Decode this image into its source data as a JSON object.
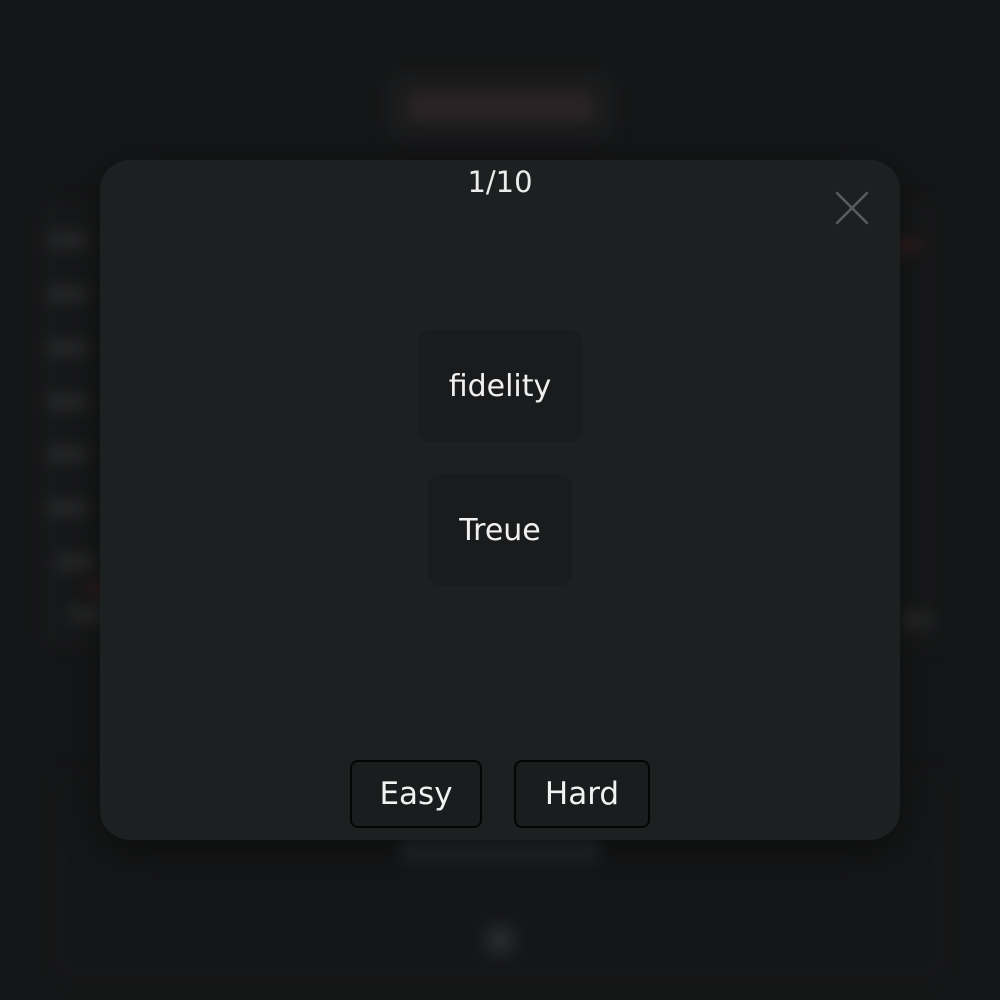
{
  "flashcard": {
    "counter": "1/10",
    "term": "fidelity",
    "translation": "Treue"
  },
  "actions": {
    "easy_label": "Easy",
    "hard_label": "Hard"
  },
  "icons": {
    "close": "close-icon"
  },
  "colors": {
    "modal_bg": "#1d2021",
    "card_bg": "#191b1c",
    "text": "#f0f0f0",
    "close_icon": "#5a5d5f"
  }
}
